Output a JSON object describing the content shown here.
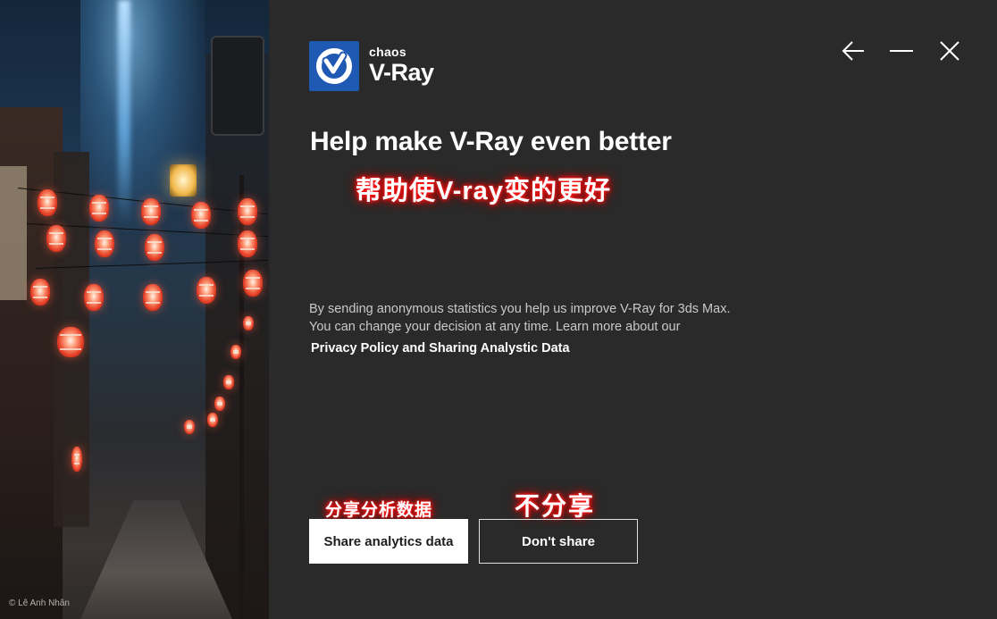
{
  "brand": {
    "company": "chaos",
    "product": "V-Ray",
    "color": "#1f59b4"
  },
  "window_controls": {
    "back_icon": "arrow-left-icon",
    "minimize_icon": "minimize-icon",
    "close_icon": "close-icon"
  },
  "main": {
    "title": "Help make V-Ray even better",
    "annotation_title_cn": "帮助使V-ray变的更好",
    "body_line1": "By sending anonymous statistics you help us improve V-Ray for 3ds Max.",
    "body_line2": "You can change your decision at any time. Learn more about our",
    "policy_link": "Privacy Policy and Sharing Analystic Data"
  },
  "buttons": {
    "share_label": "Share analytics data",
    "dont_share_label": "Don't share",
    "annotation_share_cn": "分享分析数据",
    "annotation_dont_cn": "不分享"
  },
  "image": {
    "credit": "© Lê Anh Nhân"
  }
}
